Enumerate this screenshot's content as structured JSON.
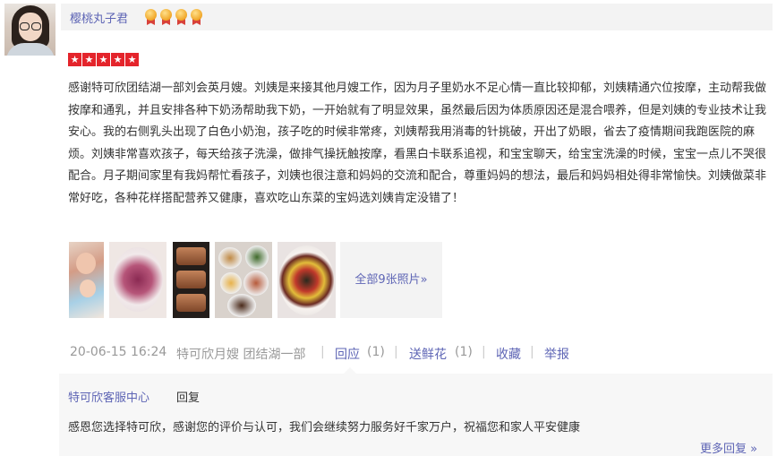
{
  "user": {
    "name": "樱桃丸子君",
    "medal_count": 4
  },
  "rating": {
    "stars": 5,
    "star_glyph": "★"
  },
  "review": {
    "text": "感谢特可欣团结湖一部刘会英月嫂。刘姨是来接其他月嫂工作，因为月子里奶水不足心情一直比较抑郁，刘姨精通穴位按摩，主动帮我做按摩和通乳，并且安排各种下奶汤帮助我下奶，一开始就有了明显效果，虽然最后因为体质原因还是混合喂养，但是刘姨的专业技术让我安心。我的右侧乳头出现了白色小奶泡，孩子吃的时候非常疼，刘姨帮我用消毒的针挑破，开出了奶眼，省去了疫情期间我跑医院的麻烦。刘姨非常喜欢孩子，每天给孩子洗澡，做排气操抚触按摩，看黑白卡联系追视，和宝宝聊天，给宝宝洗澡的时候，宝宝一点儿不哭很配合。月子期间家里有我妈帮忙看孩子，刘姨也很注意和妈妈的交流和配合，尊重妈妈的想法，最后和妈妈相处得非常愉快。刘姨做菜非常好吃，各种花样搭配营养又健康，喜欢吃山东菜的宝妈选刘姨肯定没错了！"
  },
  "photos": {
    "more_label": "全部9张照片»"
  },
  "meta": {
    "date": "20-06-15 16:24",
    "source": "特可欣月嫂 团结湖一部",
    "reply_label": "回应",
    "reply_count": "(1)",
    "flower_label": "送鲜花",
    "flower_count": "(1)",
    "collect_label": "收藏",
    "report_label": "举报",
    "separator": "|"
  },
  "reply": {
    "author": "特可欣客服中心",
    "tag": "回复",
    "text": "感恩您选择特可欣，感谢您的评价与认可，我们会继续努力服务好千家万户，祝福您和家人平安健康",
    "more_label": "更多回复 »"
  },
  "colors": {
    "link": "#5e65b5",
    "star": "#e4242b",
    "meta": "#999999"
  }
}
